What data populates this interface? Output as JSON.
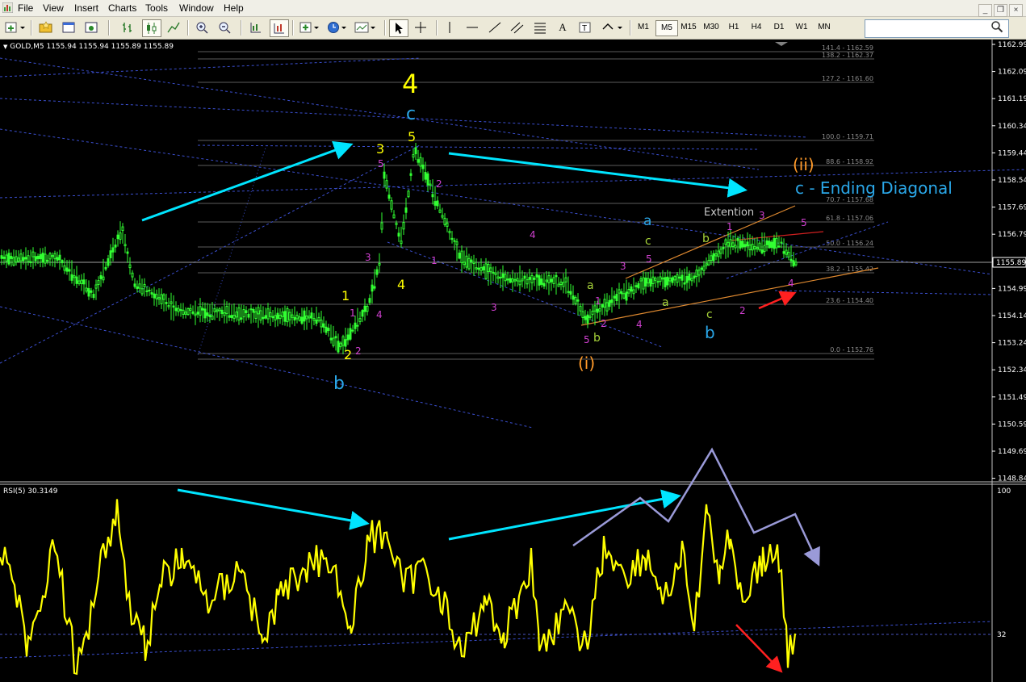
{
  "menu": [
    "File",
    "View",
    "Insert",
    "Charts",
    "Tools",
    "Window",
    "Help"
  ],
  "window_controls": {
    "minimize": "_",
    "restore": "❐",
    "close": "×"
  },
  "timeframes": [
    "M1",
    "M5",
    "M15",
    "M30",
    "H1",
    "H4",
    "D1",
    "W1",
    "MN"
  ],
  "active_timeframe": "M5",
  "toolbar_glyphs": {
    "text": "A",
    "label": "T"
  },
  "search": {
    "value": "",
    "placeholder": ""
  },
  "chart": {
    "symbol_line": "GOLD,M5  1155.94 1155.94 1155.89 1155.89",
    "current_price": "1155.89",
    "price_axis": [
      "1162.99",
      "1162.09",
      "1161.19",
      "1160.34",
      "1159.44",
      "1158.54",
      "1157.69",
      "1156.79",
      "1155.89",
      "1154.99",
      "1154.14",
      "1153.24",
      "1152.34",
      "1151.49",
      "1150.59",
      "1149.69",
      "1148.84"
    ],
    "rsi_label": "RSI(5) 30.3149",
    "rsi_axis": {
      "top": "100",
      "level": "32"
    },
    "fib_labels": [
      "141.4 - 1162.59",
      "138.2 - 1162.37",
      "127.2 - 1161.60",
      "100.0 - 1159.71",
      "88.6 - 1158.92",
      "70.7 - 1157.68",
      "61.8 - 1157.06",
      "50.0 - 1156.24",
      "38.2 - 1155.42",
      "23.6 - 1154.40",
      "0.0 - 1152.76"
    ],
    "annotations": {
      "wave4": "4",
      "wave_c_top": "c",
      "w5_top": "5",
      "w3_top": "3",
      "w1": "1",
      "w2": "2",
      "w4": "4",
      "wave_b": "b",
      "sub_1": "1",
      "sub_2": "2",
      "sub_3": "3",
      "sub_4": "4",
      "sub_5": "5",
      "m2": "2",
      "m1": "1",
      "m4": "4",
      "m3": "3",
      "wave_i": "(i)",
      "wave_ii": "(ii)",
      "ending_diagonal": "c - Ending Diagonal",
      "extention": "Extention",
      "a_blue": "a",
      "c_green": "c",
      "a_green": "a",
      "a_green2": "a",
      "b_green": "b",
      "b_green_top": "b",
      "c_green2": "c",
      "b_blue": "b",
      "p5a": "5",
      "p1a": "1",
      "p2a": "2",
      "p3a": "3",
      "p4a": "4",
      "p5b": "5",
      "p1b": "1",
      "p2b": "2",
      "p3b": "3",
      "p4b": "4",
      "p5c": "5"
    }
  }
}
